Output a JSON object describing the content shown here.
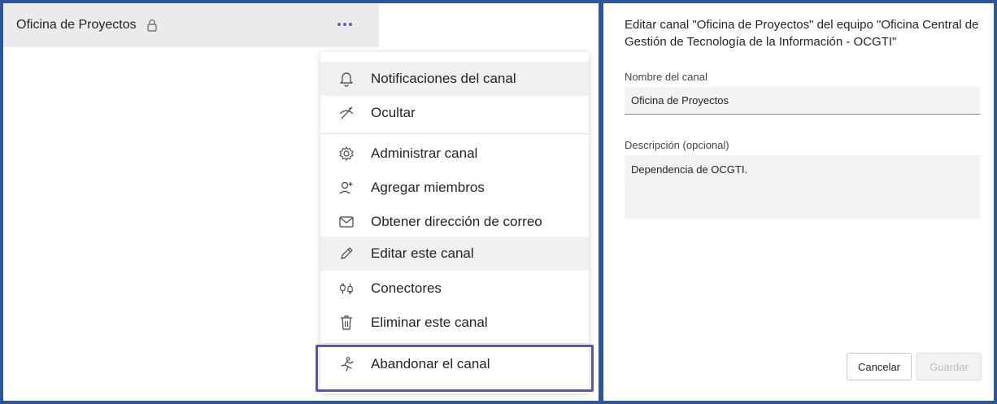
{
  "channel": {
    "name": "Oficina de Proyectos"
  },
  "menu": {
    "items": [
      {
        "label": "Notificaciones del canal",
        "icon": "bell-icon"
      },
      {
        "label": "Ocultar",
        "icon": "hide-icon"
      },
      {
        "label": "Administrar canal",
        "icon": "gear-icon"
      },
      {
        "label": "Agregar miembros",
        "icon": "add-member-icon"
      },
      {
        "label": "Obtener dirección de correo",
        "icon": "mail-icon"
      },
      {
        "label": "Editar este canal",
        "icon": "pencil-icon"
      },
      {
        "label": "Conectores",
        "icon": "connectors-icon"
      },
      {
        "label": "Eliminar este canal",
        "icon": "trash-icon"
      },
      {
        "label": "Abandonar el canal",
        "icon": "leave-icon"
      }
    ]
  },
  "dialog": {
    "title": "Editar canal \"Oficina de Proyectos\" del equipo \"Oficina Central de Gestión de Tecnología de la Información - OCGTI\"",
    "name_label": "Nombre del canal",
    "name_value": "Oficina de Proyectos",
    "desc_label": "Descripción (opcional)",
    "desc_value": "Dependencia de OCGTI.",
    "cancel_label": "Cancelar",
    "save_label": "Guardar"
  },
  "colors": {
    "frame": "#2e5597",
    "accent": "#6264a7",
    "highlight_box": "#5b55a8"
  }
}
